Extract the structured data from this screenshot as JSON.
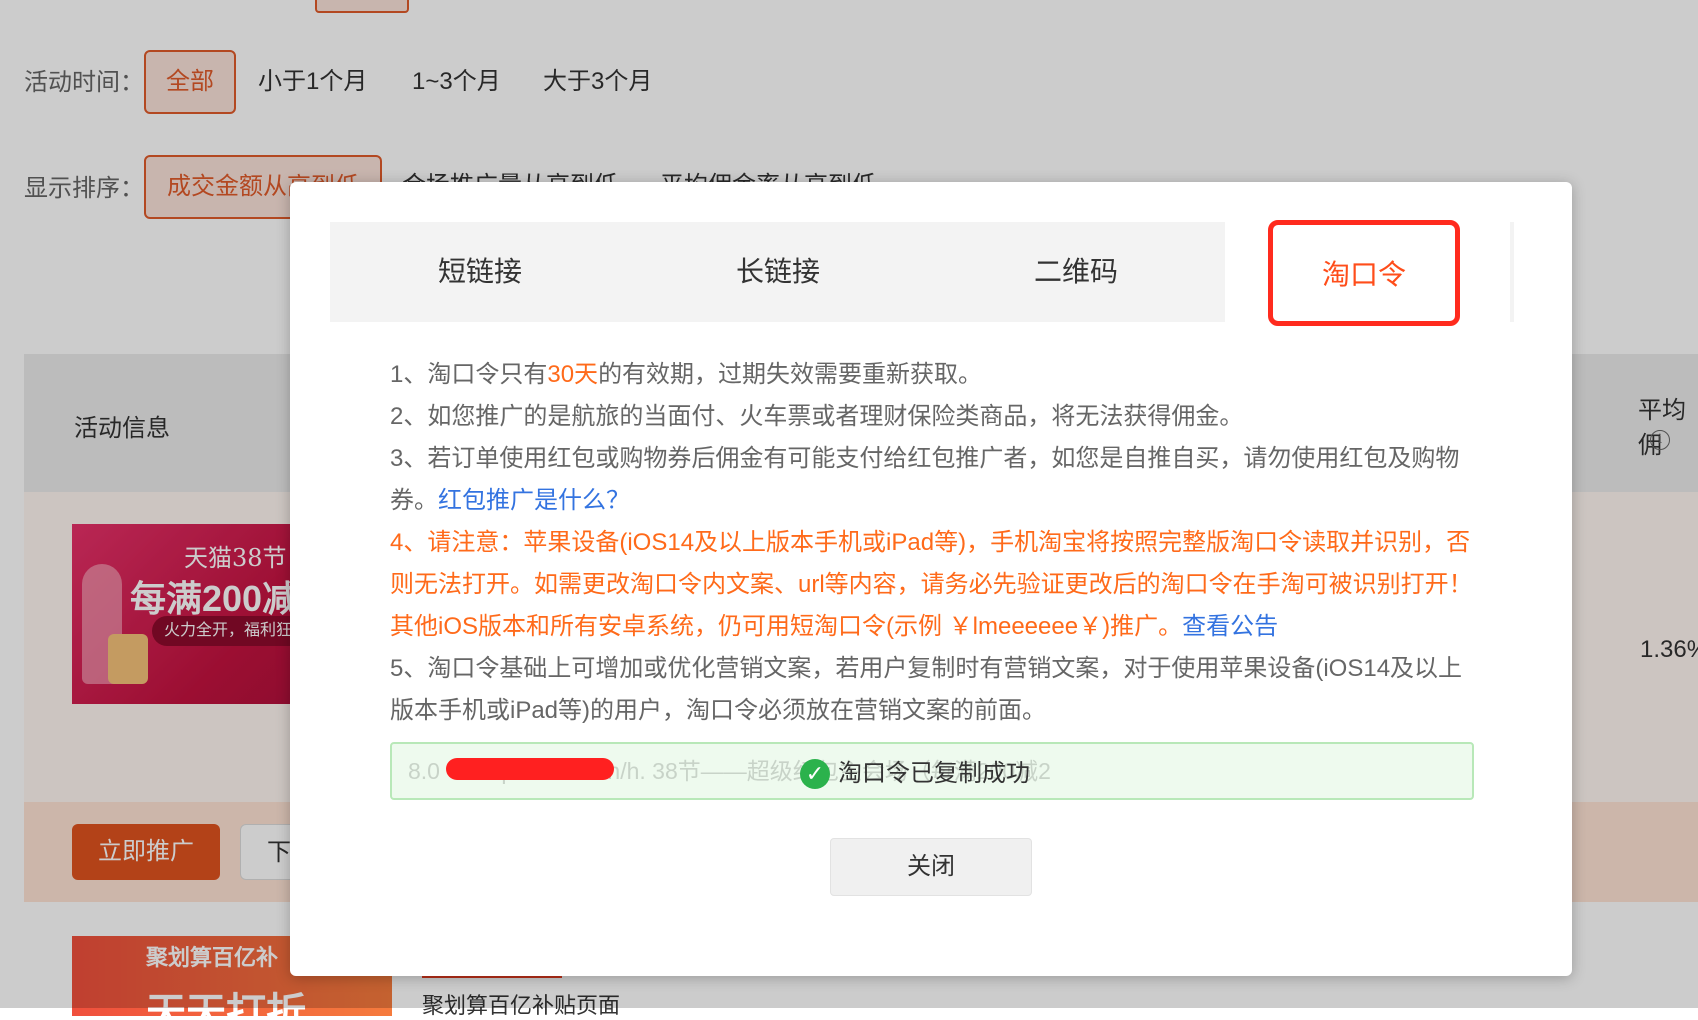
{
  "filters": {
    "time_label": "活动时间：",
    "time_options": [
      "全部",
      "小于1个月",
      "1~3个月",
      "大于3个月"
    ],
    "sort_label": "显示排序：",
    "sort_options": [
      "成交金额从高到低",
      "合场推广量从高到低",
      "平均佣金率从高到低"
    ]
  },
  "table": {
    "header_activity": "活动信息",
    "header_avg": "平均佣",
    "row1_pct": "1.36%",
    "promote_button": "立即推广",
    "download_button": "下",
    "banner1": {
      "line1": "天猫38节",
      "line2": "每满200减",
      "line3": "火力全开，福利狂"
    },
    "banner2": {
      "line1": "聚划算百亿补",
      "line2": "天天打折"
    },
    "row2_title": "聚划算百亿补贴页面"
  },
  "modal": {
    "tabs": [
      "短链接",
      "长链接",
      "二维码"
    ],
    "active_tab": "淘口令",
    "notes": {
      "n1_a": "1、淘口令只有",
      "n1_b": "30天",
      "n1_c": "的有效期，过期失效需要重新获取。",
      "n2": "2、如您推广的是航旅的当面付、火车票或者理财保险类商品，将无法获得佣金。",
      "n3": "3、若订单使用红包或购物券后佣金有可能支付给红包推广者，如您是自推自买，请勿使用红包及购物券。",
      "n3_link": "红包推广是什么？",
      "n4": "4、请注意：苹果设备(iOS14及以上版本手机或iPad等)，手机淘宝将按照完整版淘口令读取并识别，否则无法打开。如需更改淘口令内文案、url等内容，请务必先验证更改后的淘口令在手淘可被识别打开！其他iOS版本和所有安卓系统，仍可用短淘口令(示例 ￥lmeeeeee￥)推广。",
      "n4_link": "查看公告",
      "n5": "5、淘口令基础上可增加或优化营销文案，若用户复制时有营销文案，对于使用苹果设备(iOS14及以上版本手机或iPad等)的用户，淘口令必须放在营销文案的前面。"
    },
    "copy_text": "8.0                      ￥ https://m.tb.cn/h.        38节——超级红包主会场（每满200减2",
    "toast": "淘口令已复制成功",
    "close_button": "关闭"
  },
  "colors": {
    "accent": "#e0531e",
    "active_tab_border": "#ff2b1e",
    "link": "#3373e0",
    "warning": "#ff6a1a",
    "success": "#2bb24c"
  },
  "icons": {
    "info": "info-icon",
    "check": "check-circle-icon"
  }
}
